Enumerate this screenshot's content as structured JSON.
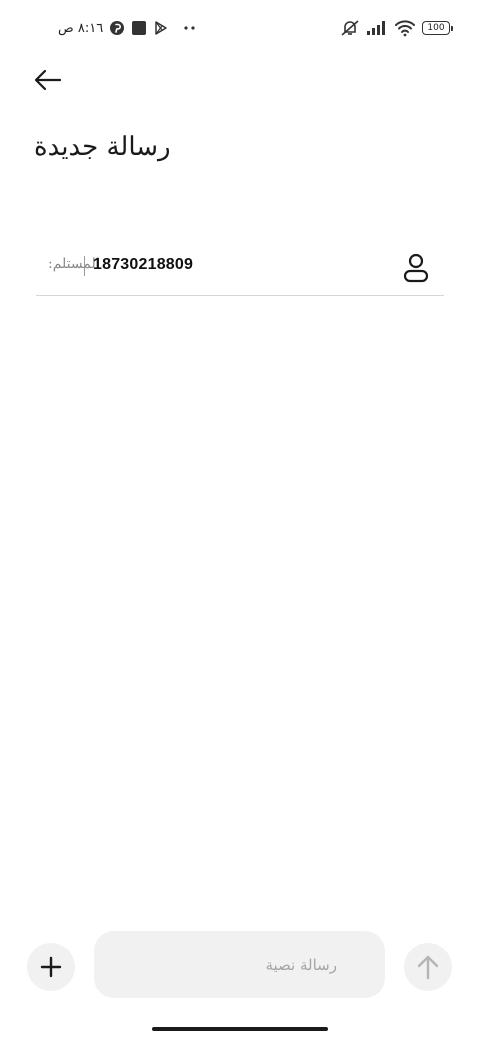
{
  "status_bar": {
    "time": "٨:١٦ ص",
    "battery": "100",
    "icons_left": [
      "pinterest-icon",
      "square-app-icon",
      "play-store-icon",
      "more-dots-icon"
    ],
    "icons_right": [
      "muted-vibrate-icon",
      "signal-icon",
      "wifi-icon",
      "battery-icon"
    ]
  },
  "header": {
    "title": "رسالة جديدة"
  },
  "recipient": {
    "label": "المستلم:",
    "value": "18730218809"
  },
  "composer": {
    "placeholder": "رسالة نصية"
  },
  "colors": {
    "background": "#ffffff",
    "button_bg": "#f1f1f1",
    "divider": "#d6d6d6",
    "placeholder": "#a5a5a5",
    "text": "#1a1a1a"
  }
}
